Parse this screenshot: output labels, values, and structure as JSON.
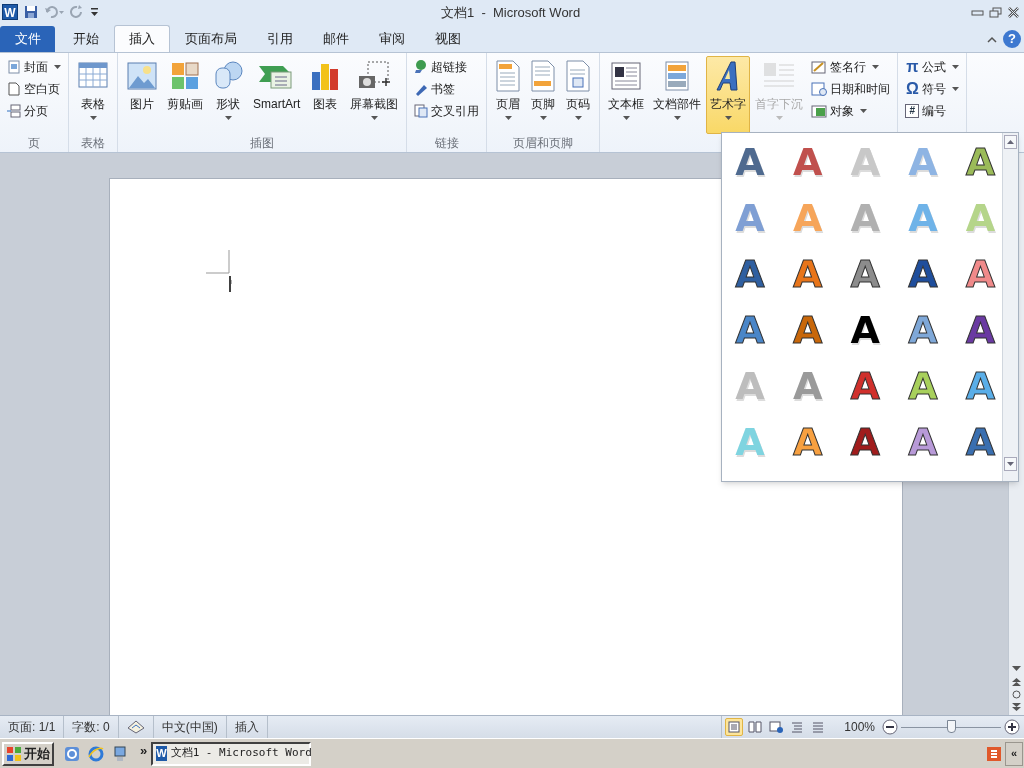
{
  "window": {
    "app_logo": "W",
    "title": "文档1  -  Microsoft Word",
    "help": "?"
  },
  "tabs": [
    {
      "label": "文件",
      "kind": "file",
      "selected": false
    },
    {
      "label": "开始",
      "kind": "tab",
      "selected": false
    },
    {
      "label": "插入",
      "kind": "tab",
      "selected": true
    },
    {
      "label": "页面布局",
      "kind": "tab",
      "selected": false
    },
    {
      "label": "引用",
      "kind": "tab",
      "selected": false
    },
    {
      "label": "邮件",
      "kind": "tab",
      "selected": false
    },
    {
      "label": "审阅",
      "kind": "tab",
      "selected": false
    },
    {
      "label": "视图",
      "kind": "tab",
      "selected": false
    }
  ],
  "ribbon": {
    "groups": [
      {
        "label": "页",
        "items": [
          {
            "kind": "small",
            "label": "封面",
            "dropdown": true,
            "selected": false,
            "disabled": false
          },
          {
            "kind": "small",
            "label": "空白页",
            "dropdown": false,
            "selected": false,
            "disabled": false
          },
          {
            "kind": "small",
            "label": "分页",
            "dropdown": false,
            "selected": false,
            "disabled": false
          }
        ]
      },
      {
        "label": "表格",
        "items": [
          {
            "kind": "large",
            "label": "表格",
            "dropdown": true,
            "selected": false,
            "disabled": false
          }
        ]
      },
      {
        "label": "插图",
        "items": [
          {
            "kind": "large",
            "label": "图片",
            "dropdown": false,
            "selected": false,
            "disabled": false
          },
          {
            "kind": "large",
            "label": "剪贴画",
            "dropdown": false,
            "selected": false,
            "disabled": false
          },
          {
            "kind": "large",
            "label": "形状",
            "dropdown": true,
            "selected": false,
            "disabled": false
          },
          {
            "kind": "large",
            "label": "SmartArt",
            "dropdown": false,
            "selected": false,
            "disabled": false
          },
          {
            "kind": "large",
            "label": "图表",
            "dropdown": false,
            "selected": false,
            "disabled": false
          },
          {
            "kind": "large",
            "label": "屏幕截图",
            "dropdown": true,
            "selected": false,
            "disabled": false
          }
        ]
      },
      {
        "label": "链接",
        "items": [
          {
            "kind": "small",
            "label": "超链接",
            "dropdown": false,
            "selected": false,
            "disabled": false
          },
          {
            "kind": "small",
            "label": "书签",
            "dropdown": false,
            "selected": false,
            "disabled": false
          },
          {
            "kind": "small",
            "label": "交叉引用",
            "dropdown": false,
            "selected": false,
            "disabled": false
          }
        ]
      },
      {
        "label": "页眉和页脚",
        "items": [
          {
            "kind": "large",
            "label": "页眉",
            "dropdown": true,
            "selected": false,
            "disabled": false
          },
          {
            "kind": "large",
            "label": "页脚",
            "dropdown": true,
            "selected": false,
            "disabled": false
          },
          {
            "kind": "large",
            "label": "页码",
            "dropdown": true,
            "selected": false,
            "disabled": false
          }
        ]
      },
      {
        "items": [
          {
            "kind": "large",
            "label": "文本框",
            "dropdown": true,
            "selected": false,
            "disabled": false
          },
          {
            "kind": "large",
            "label": "文档部件",
            "dropdown": true,
            "selected": false,
            "disabled": false
          },
          {
            "kind": "large",
            "label": "艺术字",
            "dropdown": true,
            "selected": true,
            "disabled": false
          },
          {
            "kind": "large",
            "label": "首字下沉",
            "dropdown": true,
            "selected": false,
            "disabled": true
          },
          {
            "kind": "small",
            "label": "签名行",
            "dropdown": true,
            "selected": false,
            "disabled": false
          },
          {
            "kind": "small",
            "label": "日期和时间",
            "dropdown": false,
            "selected": false,
            "disabled": false
          },
          {
            "kind": "small",
            "label": "对象",
            "dropdown": true,
            "selected": false,
            "disabled": false
          }
        ]
      },
      {
        "items": [
          {
            "kind": "small",
            "label": "公式",
            "glyph": "π",
            "dropdown": true,
            "selected": false,
            "disabled": false
          },
          {
            "kind": "small",
            "label": "符号",
            "glyph": "Ω",
            "dropdown": true,
            "selected": false,
            "disabled": false
          },
          {
            "kind": "small",
            "label": "编号",
            "glyph": "#",
            "dropdown": false,
            "selected": false,
            "disabled": false
          }
        ]
      }
    ]
  },
  "wordart_gallery": [
    {
      "label": "A",
      "kind": "outline",
      "color": "#4f6a8f"
    },
    {
      "label": "A",
      "kind": "outline",
      "color": "#c0504d"
    },
    {
      "label": "A",
      "kind": "outline",
      "color": "#c8c8c8"
    },
    {
      "label": "A",
      "kind": "outline",
      "color": "#8eb4e3"
    },
    {
      "label": "A",
      "kind": "fill",
      "color": "#9bbb59"
    },
    {
      "label": "A",
      "kind": "outline",
      "color": "#7f9fd4"
    },
    {
      "label": "A",
      "kind": "outline",
      "color": "#f6a55a"
    },
    {
      "label": "A",
      "kind": "outline",
      "color": "#b0b0b0"
    },
    {
      "label": "A",
      "kind": "outline",
      "color": "#6fb3e8"
    },
    {
      "label": "A",
      "kind": "outline",
      "color": "#b5d58a"
    },
    {
      "label": "A",
      "kind": "fill",
      "color": "#2f5fa0"
    },
    {
      "label": "A",
      "kind": "fill",
      "color": "#e8751a"
    },
    {
      "label": "A",
      "kind": "fill",
      "color": "#8c8c8c"
    },
    {
      "label": "A",
      "kind": "fill",
      "color": "#1f4e9c"
    },
    {
      "label": "A",
      "kind": "fill",
      "color": "#f08a8a"
    },
    {
      "label": "A",
      "kind": "fill",
      "color": "#4a86c8"
    },
    {
      "label": "A",
      "kind": "fill",
      "color": "#c8670a"
    },
    {
      "label": "A",
      "kind": "outline",
      "color": "#000000"
    },
    {
      "label": "A",
      "kind": "fill",
      "color": "#7fa8d8"
    },
    {
      "label": "A",
      "kind": "fill",
      "color": "#6a3aa2"
    },
    {
      "label": "A",
      "kind": "outline",
      "color": "#bdbdbd"
    },
    {
      "label": "A",
      "kind": "outline",
      "color": "#9a9a9a"
    },
    {
      "label": "A",
      "kind": "fill",
      "color": "#d0302c"
    },
    {
      "label": "A",
      "kind": "fill",
      "color": "#a8d05c"
    },
    {
      "label": "A",
      "kind": "fill",
      "color": "#5aaee8"
    },
    {
      "label": "A",
      "kind": "outline",
      "color": "#7fd4e0"
    },
    {
      "label": "A",
      "kind": "fill",
      "color": "#f7a040"
    },
    {
      "label": "A",
      "kind": "fill",
      "color": "#a01c1c"
    },
    {
      "label": "A",
      "kind": "fill",
      "color": "#b89ad8"
    },
    {
      "label": "A",
      "kind": "fill",
      "color": "#3a6fb0"
    }
  ],
  "status_bar": {
    "items": [
      {
        "kind": "text",
        "label": "页面: 1/1"
      },
      {
        "kind": "text",
        "label": "字数: 0"
      },
      {
        "kind": "icon"
      },
      {
        "kind": "text",
        "label": "中文(中国)"
      },
      {
        "kind": "text",
        "label": "插入"
      }
    ],
    "views": [
      {
        "selected": true
      },
      {
        "selected": false
      },
      {
        "selected": false
      },
      {
        "selected": false
      },
      {
        "selected": false
      }
    ],
    "zoom": "100%",
    "zoom_slider": {
      "level": 0.5
    }
  },
  "taskbar": {
    "start": "开始",
    "more": "»",
    "tasks": [
      {
        "logo": "W",
        "label": "文档1 - Microsoft Word",
        "selected": true
      }
    ],
    "expand": "«"
  }
}
